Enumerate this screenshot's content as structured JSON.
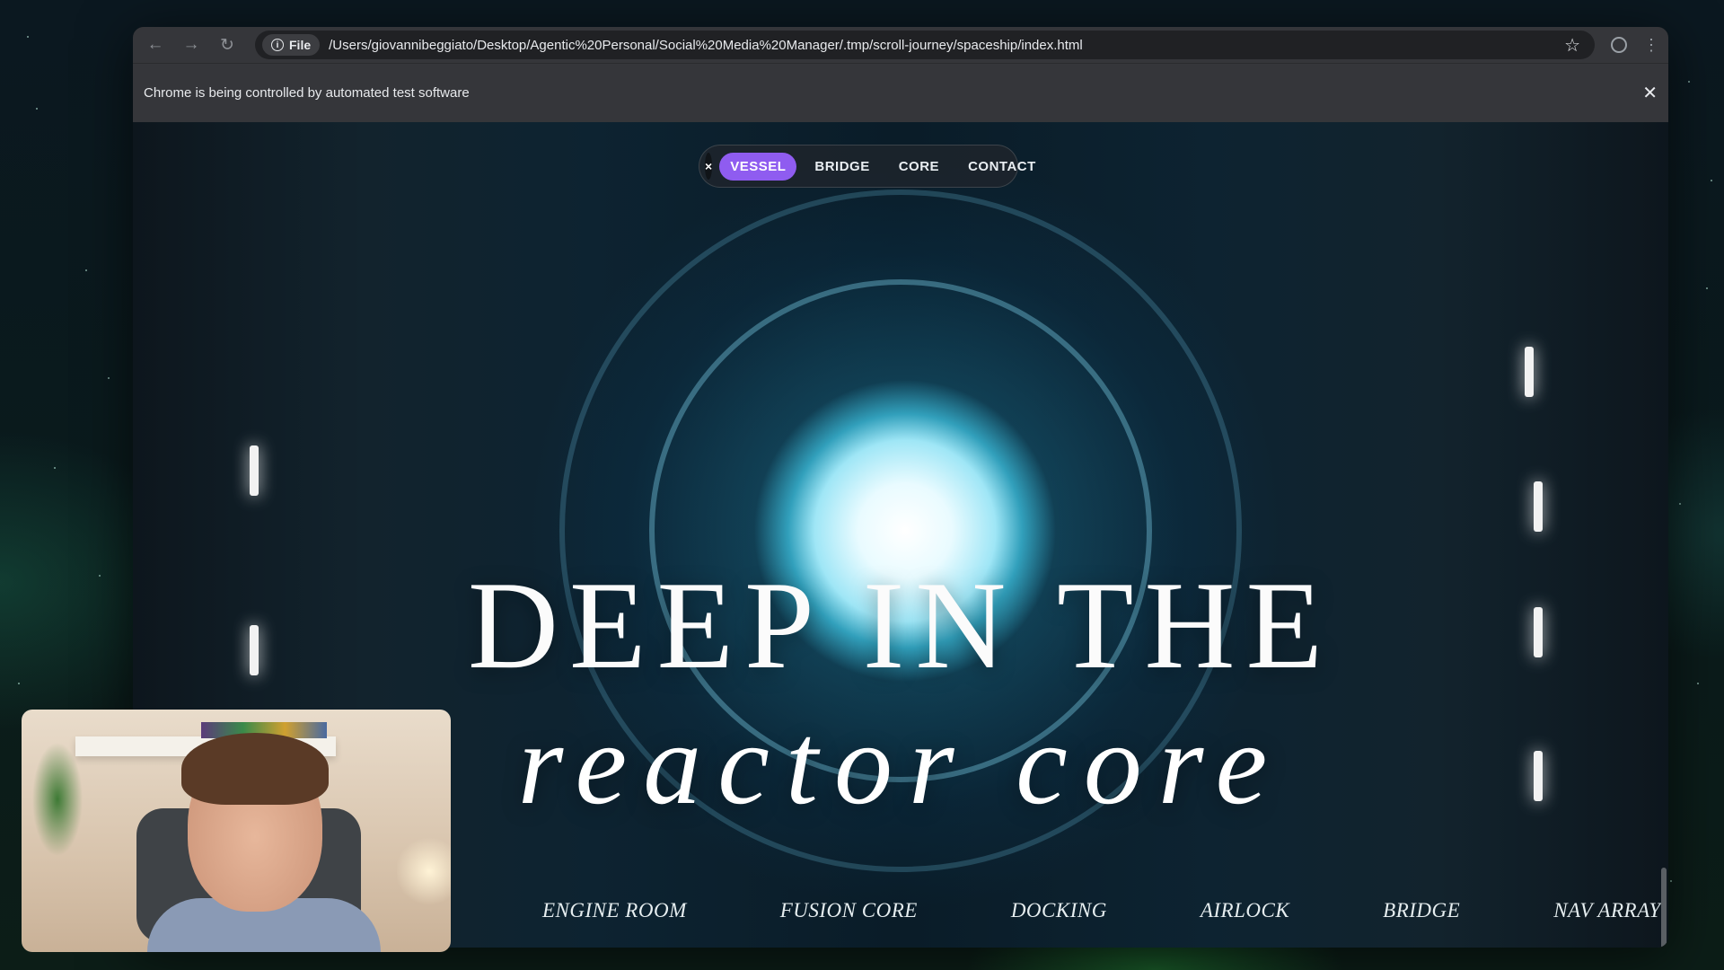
{
  "browser": {
    "scheme_chip": "File",
    "url": "/Users/giovannibeggiato/Desktop/Agentic%20Personal/Social%20Media%20Manager/.tmp/scroll-journey/spaceship/index.html",
    "infobar_text": "Chrome is being controlled by automated test software",
    "icons": {
      "back": "back-arrow-icon",
      "forward": "forward-arrow-icon",
      "reload": "reload-icon",
      "info": "info-icon",
      "bookmark": "star-icon",
      "profile": "profile-icon",
      "menu": "kebab-menu-icon",
      "close": "close-icon"
    }
  },
  "page": {
    "nav": {
      "close_label": "×",
      "items": [
        "VESSEL",
        "BRIDGE",
        "CORE",
        "CONTACT"
      ],
      "active": "VESSEL",
      "accent_color": "#8f5cf0"
    },
    "hero": {
      "title": "DEEP IN THE",
      "subtitle": "reactor core"
    },
    "sections": [
      "ENGINE ROOM",
      "FUSION CORE",
      "DOCKING",
      "AIRLOCK",
      "BRIDGE",
      "NAV ARRAY"
    ]
  }
}
